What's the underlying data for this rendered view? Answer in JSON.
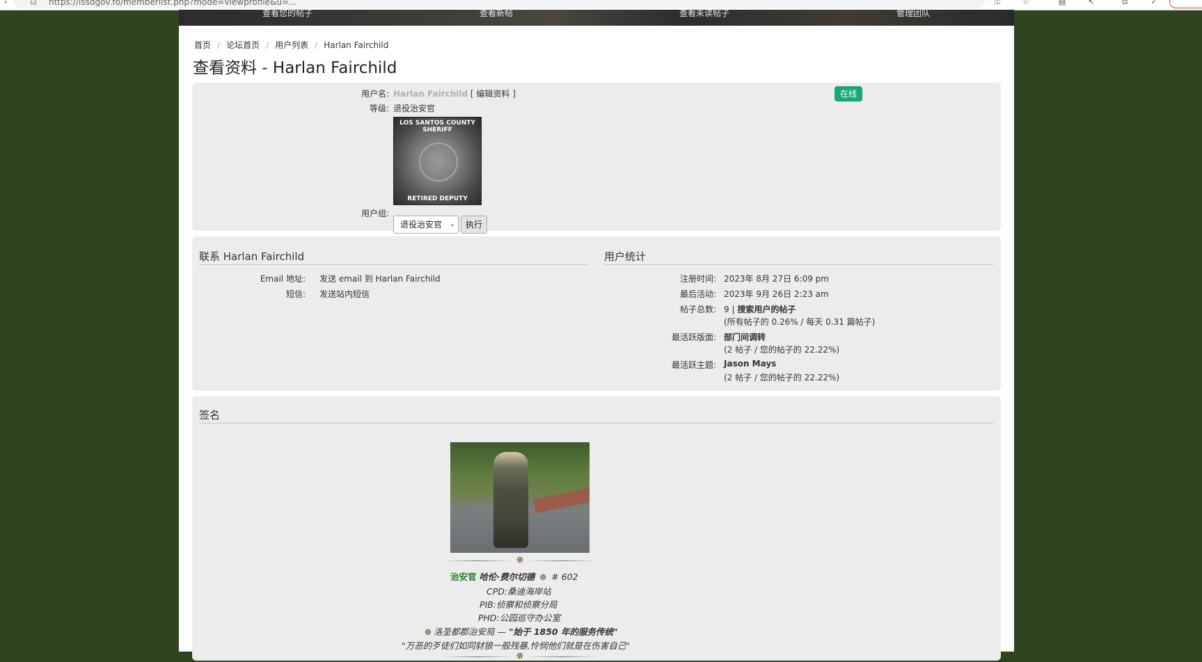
{
  "browser": {
    "url": "https://lssdgov.fo/memberlist.php?mode=viewprofile&u=..."
  },
  "header": {
    "nav": [
      "查看您的帖子",
      "查看新帖",
      "查看未读帖子",
      "管理团队"
    ]
  },
  "breadcrumb": [
    "首页",
    "论坛首页",
    "用户列表",
    "Harlan Fairchild"
  ],
  "title": "查看资料 - Harlan Fairchild",
  "profile": {
    "username_label": "用户名:",
    "username": "Harlan Fairchild",
    "edit_link": "[ 编辑资料 ]",
    "rank_label": "等级:",
    "rank": "退役治安官",
    "rank_image_top": "LOS SANTOS COUNTY SHERIFF",
    "rank_image_bottom": "RETIRED DEPUTY",
    "group_label": "用户组:",
    "group_selected": "退役治安官",
    "go_label": "执行",
    "online": "在线"
  },
  "contact": {
    "title": "联系 Harlan Fairchild",
    "email_label": "Email 地址:",
    "email_value": "发送 email 到 Harlan Fairchild",
    "pm_label": "短信:",
    "pm_value": "发送站内短信"
  },
  "stats": {
    "title": "用户统计",
    "joined_label": "注册时间:",
    "joined": "2023年 8月 27日 6:09 pm",
    "last_label": "最后活动:",
    "last": "2023年 9月 26日 2:23 am",
    "posts_label": "帖子总数:",
    "posts_count": "9",
    "posts_sep": " | ",
    "posts_search": "搜索用户的帖子",
    "posts_detail": "(所有帖子的 0.26% / 每天 0.31 篇帖子)",
    "active_forum_label": "最活跃版面:",
    "active_forum": "部门间调转",
    "active_forum_detail": "(2 帖子 / 您的帖子的 22.22%)",
    "active_topic_label": "最活跃主题:",
    "active_topic": "Jason Mays",
    "active_topic_detail": "(2 帖子 / 您的帖子的 22.22%)"
  },
  "signature": {
    "title": "签名",
    "rank_word": "治安官",
    "name": "哈伦·费尔切德",
    "badge_no": "# 602",
    "line1": "CPD:桑迪海岸站",
    "line2": "PIB:侦察和侦察分局",
    "line3": "PHD:公园巡守办公室",
    "dept_prefix": "洛圣都郡治安局 — ",
    "dept_quote": "\"始于 1850 年的服务传统\"",
    "motto": "\"万恶的歹徒们如同豺狼一般残暴,怜悯他们就是在伤害自己\""
  },
  "colors": {
    "background": "#2f4520",
    "panel": "#ececec",
    "online_badge": "#18a77a",
    "rank_green": "#2a7a2a"
  }
}
